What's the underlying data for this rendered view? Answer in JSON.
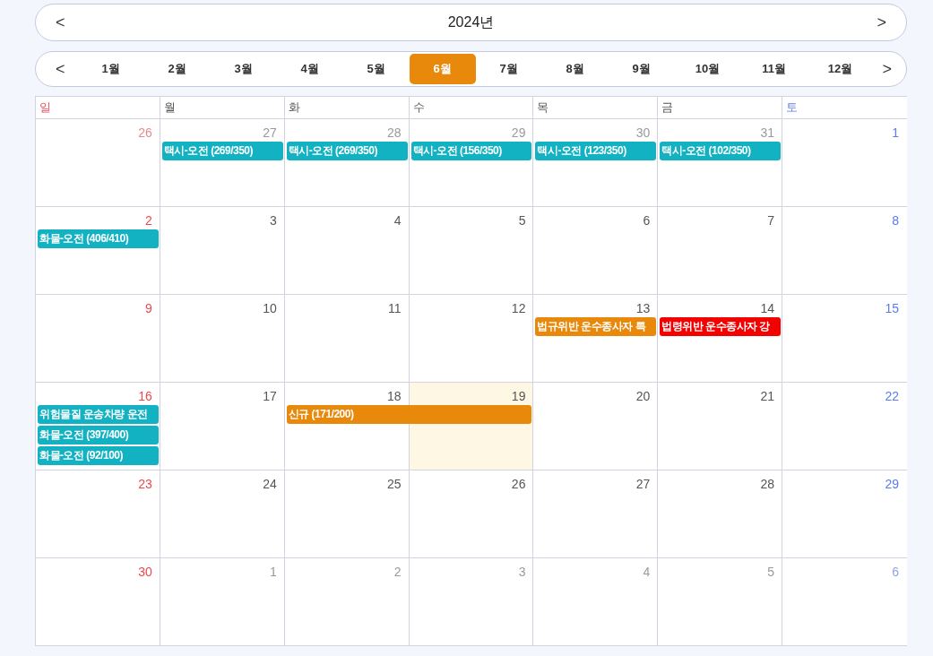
{
  "year_bar": {
    "prev": "<",
    "title": "2024년",
    "next": ">"
  },
  "month_bar": {
    "prev": "<",
    "next": ">",
    "months": [
      {
        "label": "1월",
        "selected": false
      },
      {
        "label": "2월",
        "selected": false
      },
      {
        "label": "3월",
        "selected": false
      },
      {
        "label": "4월",
        "selected": false
      },
      {
        "label": "5월",
        "selected": false
      },
      {
        "label": "6월",
        "selected": true
      },
      {
        "label": "7월",
        "selected": false
      },
      {
        "label": "8월",
        "selected": false
      },
      {
        "label": "9월",
        "selected": false
      },
      {
        "label": "10월",
        "selected": false
      },
      {
        "label": "11월",
        "selected": false
      },
      {
        "label": "12월",
        "selected": false
      }
    ]
  },
  "weekdays": [
    "일",
    "월",
    "화",
    "수",
    "목",
    "금",
    "토"
  ],
  "weeks": [
    {
      "days": [
        {
          "day": "26",
          "other_month": true,
          "today": false
        },
        {
          "day": "27",
          "other_month": true,
          "today": false,
          "events": [
            {
              "title": "택시-오전 (269/350)",
              "continues_next_day": false,
              "color": "#12b2c2"
            }
          ]
        },
        {
          "day": "28",
          "other_month": true,
          "today": false,
          "events": [
            {
              "title": "택시-오전 (269/350)",
              "continues_next_day": false,
              "color": "#12b2c2"
            }
          ]
        },
        {
          "day": "29",
          "other_month": true,
          "today": false,
          "events": [
            {
              "title": "택시-오전 (156/350)",
              "continues_next_day": false,
              "color": "#12b2c2"
            }
          ]
        },
        {
          "day": "30",
          "other_month": true,
          "today": false,
          "events": [
            {
              "title": "택시-오전 (123/350)",
              "continues_next_day": false,
              "color": "#12b2c2"
            }
          ]
        },
        {
          "day": "31",
          "other_month": true,
          "today": false,
          "events": [
            {
              "title": "택시-오전 (102/350)",
              "continues_next_day": false,
              "color": "#12b2c2"
            }
          ]
        },
        {
          "day": "1",
          "other_month": false,
          "today": false
        }
      ]
    },
    {
      "days": [
        {
          "day": "2",
          "other_month": false,
          "today": false,
          "events": [
            {
              "title": "화물-오전 (406/410)",
              "continues_next_day": false,
              "color": "#12b2c2"
            }
          ]
        },
        {
          "day": "3",
          "other_month": false,
          "today": false
        },
        {
          "day": "4",
          "other_month": false,
          "today": false
        },
        {
          "day": "5",
          "other_month": false,
          "today": false
        },
        {
          "day": "6",
          "other_month": false,
          "today": false
        },
        {
          "day": "7",
          "other_month": false,
          "today": false
        },
        {
          "day": "8",
          "other_month": false,
          "today": false
        }
      ]
    },
    {
      "days": [
        {
          "day": "9",
          "other_month": false,
          "today": false
        },
        {
          "day": "10",
          "other_month": false,
          "today": false
        },
        {
          "day": "11",
          "other_month": false,
          "today": false
        },
        {
          "day": "12",
          "other_month": false,
          "today": false
        },
        {
          "day": "13",
          "other_month": false,
          "today": false,
          "events": [
            {
              "title": "법규위반 운수종사자 특",
              "continues_next_day": false,
              "color": "#e8890c"
            }
          ]
        },
        {
          "day": "14",
          "other_month": false,
          "today": false,
          "events": [
            {
              "title": "법령위반 운수종사자 강",
              "continues_next_day": false,
              "color": "#f50000"
            }
          ]
        },
        {
          "day": "15",
          "other_month": false,
          "today": false
        }
      ]
    },
    {
      "days": [
        {
          "day": "16",
          "other_month": false,
          "today": false,
          "events": [
            {
              "title": "위험물질 운송차량 운전",
              "continues_next_day": false,
              "color": "#12b2c2"
            },
            {
              "title": "화물-오전 (397/400)",
              "continues_next_day": false,
              "color": "#12b2c2"
            },
            {
              "title": "화물-오전 (92/100)",
              "continues_next_day": false,
              "color": "#12b2c2"
            }
          ]
        },
        {
          "day": "17",
          "other_month": false,
          "today": false
        },
        {
          "day": "18",
          "other_month": false,
          "today": false,
          "events": [
            {
              "title": "신규 (171/200)",
              "continues_next_day": true,
              "color": "#e8890c"
            }
          ]
        },
        {
          "day": "19",
          "other_month": false,
          "today": true
        },
        {
          "day": "20",
          "other_month": false,
          "today": false
        },
        {
          "day": "21",
          "other_month": false,
          "today": false
        },
        {
          "day": "22",
          "other_month": false,
          "today": false
        }
      ]
    },
    {
      "days": [
        {
          "day": "23",
          "other_month": false,
          "today": false
        },
        {
          "day": "24",
          "other_month": false,
          "today": false
        },
        {
          "day": "25",
          "other_month": false,
          "today": false
        },
        {
          "day": "26",
          "other_month": false,
          "today": false
        },
        {
          "day": "27",
          "other_month": false,
          "today": false
        },
        {
          "day": "28",
          "other_month": false,
          "today": false
        },
        {
          "day": "29",
          "other_month": false,
          "today": false
        }
      ]
    },
    {
      "days": [
        {
          "day": "30",
          "other_month": false,
          "today": false
        },
        {
          "day": "1",
          "other_month": true,
          "today": false
        },
        {
          "day": "2",
          "other_month": true,
          "today": false
        },
        {
          "day": "3",
          "other_month": true,
          "today": false
        },
        {
          "day": "4",
          "other_month": true,
          "today": false
        },
        {
          "day": "5",
          "other_month": true,
          "today": false
        },
        {
          "day": "6",
          "other_month": true,
          "today": false
        }
      ]
    }
  ]
}
